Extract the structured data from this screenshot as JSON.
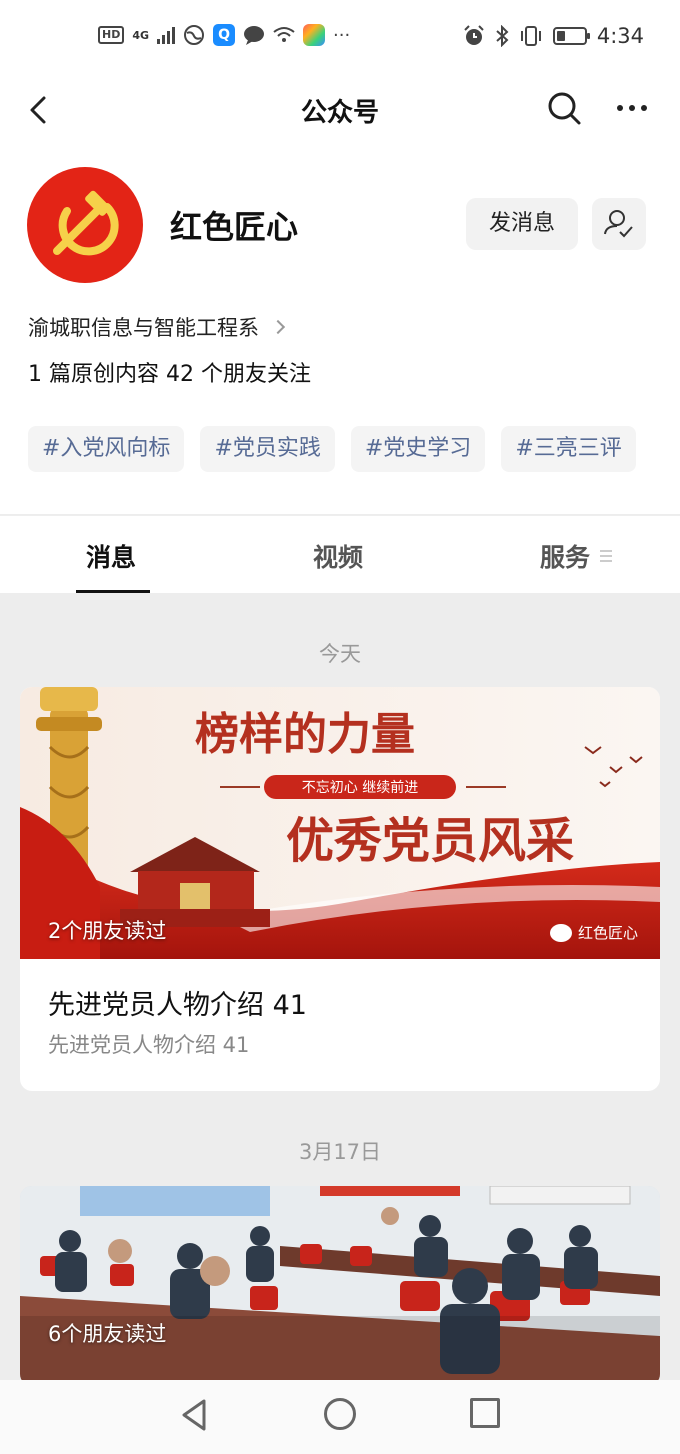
{
  "status_bar": {
    "hd": "HD",
    "network": "4G",
    "more": "···",
    "time": "4:34"
  },
  "nav": {
    "title": "公众号"
  },
  "profile": {
    "name": "红色匠心",
    "send_message_label": "发消息",
    "org_link": "渝城职信息与智能工程系",
    "stats": "1 篇原创内容  42 个朋友关注",
    "tags": [
      "#入党风向标",
      "#党员实践",
      "#党史学习",
      "#三亮三评"
    ]
  },
  "tabs": [
    {
      "label": "消息",
      "active": true
    },
    {
      "label": "视频",
      "active": false
    },
    {
      "label": "服务",
      "active": false
    }
  ],
  "feed": [
    {
      "date": "今天",
      "cover_title": "榜样的力量",
      "cover_slogan": "不忘初心 继续前进",
      "cover_subtitle": "优秀党员风采",
      "cover_watermark": "红色匠心",
      "read_by": "2个朋友读过",
      "title": "先进党员人物介绍 41",
      "summary": "先进党员人物介绍 41"
    },
    {
      "date": "3月17日",
      "read_by": "6个朋友读过"
    }
  ],
  "colors": {
    "accent_link": "#576b95",
    "party_red": "#e32416",
    "gold": "#f6d14a"
  }
}
